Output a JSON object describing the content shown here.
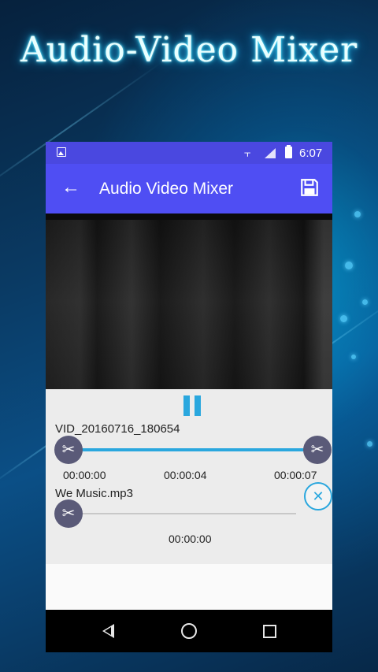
{
  "promo": {
    "headline": "Audio-Video Mixer"
  },
  "status_bar": {
    "time": "6:07",
    "icons": [
      "image-icon",
      "vibrate-icon",
      "signal-icon",
      "battery-icon"
    ]
  },
  "app_bar": {
    "title": "Audio Video Mixer",
    "back_icon": "arrow-back-icon",
    "save_icon": "save-icon"
  },
  "player": {
    "state_icon": "pause-icon"
  },
  "video_track": {
    "file_name": "VID_20160716_180654",
    "start_time": "00:00:00",
    "current_time": "00:00:04",
    "end_time": "00:00:07"
  },
  "audio_track": {
    "file_name": "We Music.mp3",
    "time": "00:00:00"
  },
  "nav_bar": {
    "icons": [
      "nav-back-icon",
      "nav-home-icon",
      "nav-recents-icon"
    ]
  },
  "colors": {
    "accent": "#2aa7de",
    "app_bar": "#4f4ef3",
    "status_bar": "#4a48e0",
    "scissor_handle": "#5a5a78"
  }
}
